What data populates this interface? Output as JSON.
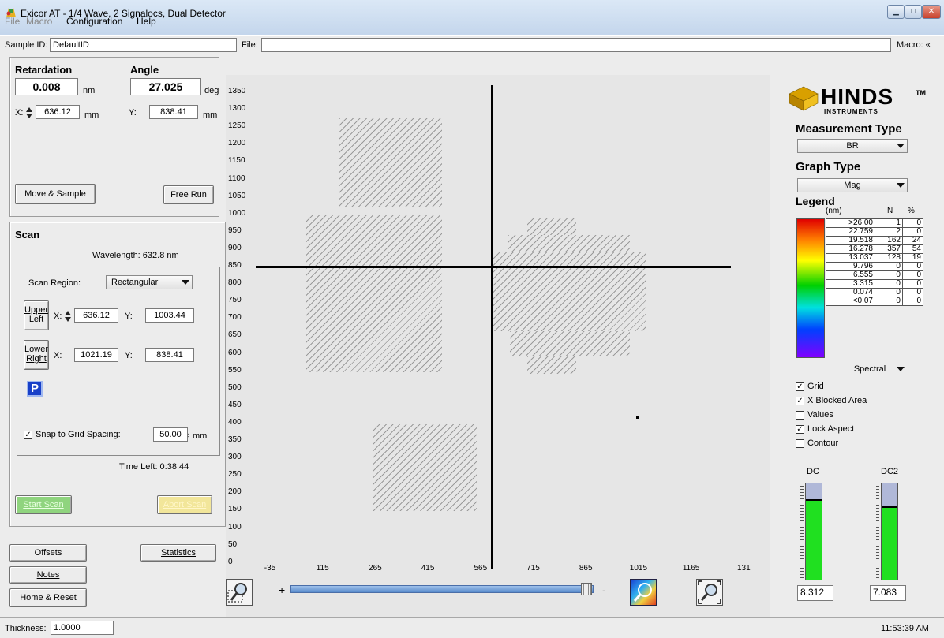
{
  "window": {
    "title": "Exicor AT - 1/4 Wave, 2 Signalocs, Dual Detector"
  },
  "menu": {
    "file": "File",
    "macro": "Macro",
    "configuration": "Configuration",
    "help": "Help"
  },
  "idbar": {
    "sample_label": "Sample ID:",
    "sample_value": "DefaultID",
    "file_label": "File:",
    "file_value": "",
    "macro_label": "Macro: «"
  },
  "measure": {
    "retardation_label": "Retardation",
    "retardation_value": "0.008",
    "retardation_unit": "nm",
    "angle_label": "Angle",
    "angle_value": "27.025",
    "angle_unit": "deg",
    "x_label": "X:",
    "x_value": "636.12",
    "x_unit": "mm",
    "y_label": "Y:",
    "y_value": "838.41",
    "y_unit": "mm",
    "move_sample": "Move & Sample",
    "free_run": "Free Run"
  },
  "scan": {
    "title": "Scan",
    "wavelength": "Wavelength: 632.8 nm",
    "region_label": "Scan Region:",
    "region_value": "Rectangular",
    "upper_left": "Upper\nLeft",
    "ul_x": "636.12",
    "ul_y": "1003.44",
    "lower_right": "Lower\nRight",
    "lr_x": "1021.19",
    "lr_y": "838.41",
    "x_label": "X:",
    "y_label": "Y:",
    "p_button": "P",
    "snap_label": "Snap to Grid Spacing:",
    "snap_value": "50.00",
    "snap_unit": "mm",
    "time_left": "Time Left:  0:38:44",
    "start": "Start Scan",
    "abort": "Abort Scan"
  },
  "bottom": {
    "offsets": "Offsets",
    "statistics": "Statistics",
    "notes": "Notes",
    "home_reset": "Home & Reset",
    "thickness_label": "Thickness:",
    "thickness_value": "1.0000",
    "clock": "11:53:39 AM"
  },
  "chart_data": {
    "type": "heatmap",
    "yticks": [
      "1350",
      "1300",
      "1250",
      "1200",
      "1150",
      "1100",
      "1050",
      "1000",
      "950",
      "900",
      "850",
      "800",
      "750",
      "700",
      "650",
      "600",
      "550",
      "500",
      "450",
      "400",
      "350",
      "300",
      "250",
      "200",
      "150",
      "100",
      "50",
      "0"
    ],
    "xticks": [
      "-35",
      "115",
      "265",
      "415",
      "565",
      "715",
      "865",
      "1015",
      "1165",
      "131"
    ],
    "crosshair": {
      "x": 636.12,
      "y": 838.41
    }
  },
  "zoom": {
    "plus": "+",
    "minus": "-"
  },
  "right": {
    "brand": "HINDS",
    "brand_sub": "INSTRUMENTS",
    "tm": "TM",
    "meas_type_label": "Measurement Type",
    "meas_type_value": "BR",
    "graph_type_label": "Graph Type",
    "graph_type_value": "Mag",
    "legend_label": "Legend",
    "legend_unit": "(nm)",
    "col_n": "N",
    "col_pct": "%",
    "spectral": "Spectral"
  },
  "legend_rows": [
    {
      "v": ">26.00",
      "n": "1",
      "p": "0"
    },
    {
      "v": "22.759",
      "n": "2",
      "p": "0"
    },
    {
      "v": "19.518",
      "n": "162",
      "p": "24"
    },
    {
      "v": "16.278",
      "n": "357",
      "p": "54"
    },
    {
      "v": "13.037",
      "n": "128",
      "p": "19"
    },
    {
      "v": "9.796",
      "n": "0",
      "p": "0"
    },
    {
      "v": "6.555",
      "n": "0",
      "p": "0"
    },
    {
      "v": "3.315",
      "n": "0",
      "p": "0"
    },
    {
      "v": "0.074",
      "n": "0",
      "p": "0"
    },
    {
      "v": "<0.07",
      "n": "0",
      "p": "0"
    }
  ],
  "options": {
    "grid": "Grid",
    "xblocked": "X Blocked Area",
    "values": "Values",
    "lock": "Lock Aspect",
    "contour": "Contour"
  },
  "detectors": {
    "dc_label": "DC",
    "dc_value": "8.312",
    "dc_level": 0.84,
    "dc2_label": "DC2",
    "dc2_value": "7.083",
    "dc2_level": 0.76
  }
}
